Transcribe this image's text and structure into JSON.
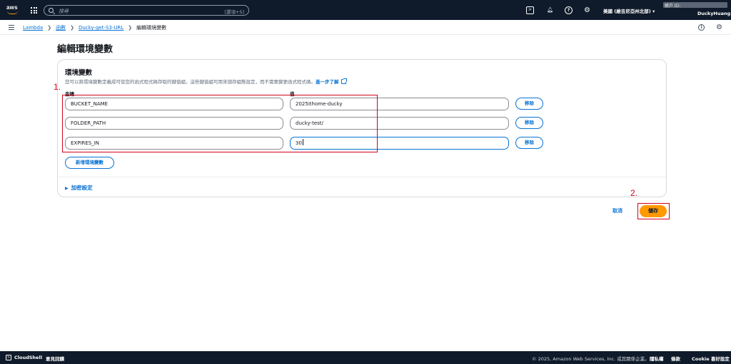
{
  "topnav": {
    "logo_text": "aws",
    "search_placeholder": "搜尋",
    "search_shortcut": "[選項+S]",
    "region": "美國 (維吉尼亞州北部) ▾",
    "account_label": "帳戶 ID:",
    "user": "DuckyHuang"
  },
  "breadcrumb": {
    "items": [
      "Lambda",
      "函數",
      "Ducky-get-S3-URL"
    ],
    "current": "編輯環境變數"
  },
  "page": {
    "title": "編輯環境變數"
  },
  "panel": {
    "title": "環境變數",
    "description": "您可以將環境變數定義成可從您的函式程式碼存取的鍵值組，這些鍵值組可用來儲存組態設定，而不需要變更函式程式碼。",
    "learn_more": "進一步了解",
    "key_header": "金鑰",
    "value_header": "值",
    "rows": [
      {
        "key": "BUCKET_NAME",
        "value": "2025ithome-ducky",
        "remove": "移除"
      },
      {
        "key": "FOLDER_PATH",
        "value": "ducky-test/",
        "remove": "移除"
      },
      {
        "key": "EXPIRES_IN",
        "value": "30",
        "remove": "移除"
      }
    ],
    "add_button": "新增環境變數",
    "encryption": "加密設定"
  },
  "annotations": {
    "step1": "1.",
    "step2": "2."
  },
  "actions": {
    "cancel": "取消",
    "save": "儲存"
  },
  "footer": {
    "cloudshell": "CloudShell",
    "feedback": "意見回饋",
    "copyright": "© 2025, Amazon Web Services, Inc. 或其關係企業。",
    "privacy": "隱私權",
    "terms": "條款",
    "cookie": "Cookie 喜好設定"
  },
  "colors": {
    "nav_bg": "#0f1b2a",
    "link": "#0972d3",
    "primary_button": "#ff9900",
    "annotation": "#d0021b"
  }
}
